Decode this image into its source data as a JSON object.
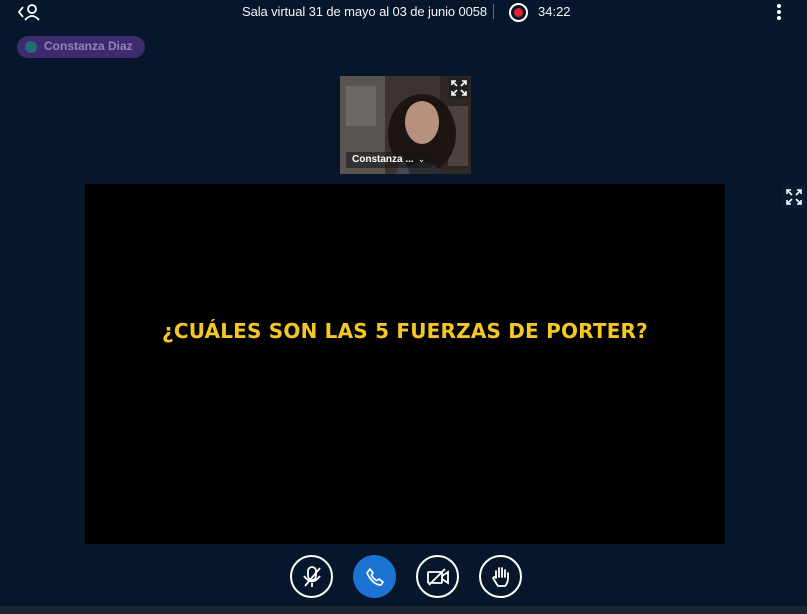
{
  "meeting": {
    "title": "Sala virtual 31 de mayo al 03 de junio 0058",
    "recording_time": "34:22"
  },
  "talking_indicator": {
    "name": "Constanza Diaz"
  },
  "webcam": {
    "user_label": "Constanza ...",
    "caret": "⌄"
  },
  "presentation": {
    "slide_text": "¿CUÁLES SON LAS 5 FUERZAS DE PORTER?"
  },
  "action_bar": {
    "buttons": [
      "microphone-muted",
      "leave-audio-phone",
      "camera-off",
      "raise-hand"
    ]
  },
  "colors": {
    "background": "#06172b",
    "accent_blue": "#1b74d1",
    "recording_red": "#e5202a",
    "slide_text": "#f5c724",
    "talker_pill": "#3e2a6e"
  },
  "icons": {
    "users_toggle": "user-list-icon",
    "options": "vertical-dots-icon",
    "fullscreen": "expand-icon"
  }
}
